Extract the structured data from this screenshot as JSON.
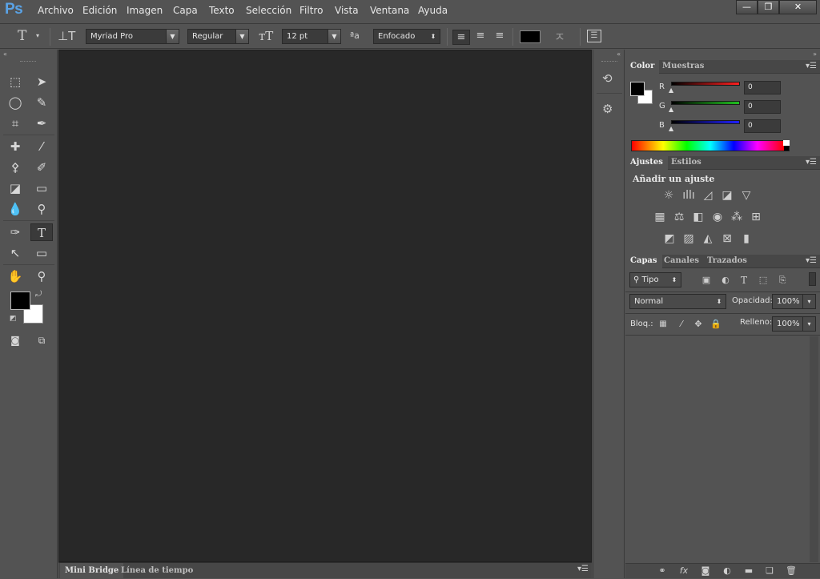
{
  "app": {
    "logo": "Ps",
    "accent": "#5aa3e6"
  },
  "menu": [
    "Archivo",
    "Edición",
    "Imagen",
    "Capa",
    "Texto",
    "Selección",
    "Filtro",
    "Vista",
    "Ventana",
    "Ayuda"
  ],
  "window_buttons": {
    "minimize": "—",
    "restore": "❐",
    "close": "✕"
  },
  "options": {
    "font_family": "Myriad Pro",
    "font_style": "Regular",
    "font_size": "12 pt",
    "antialias": "Enfocado",
    "text_color": "#000000"
  },
  "tools_icons": [
    "marquee-icon",
    "move-icon",
    "lasso-icon",
    "quick-selection-icon",
    "crop-icon",
    "eyedropper-icon",
    "healing-icon",
    "brush-icon",
    "stamp-icon",
    "history-brush-icon",
    "eraser-icon",
    "gradient-icon",
    "blur-icon",
    "dodge-icon",
    "pen-icon",
    "type-icon",
    "path-selection-icon",
    "rectangle-icon",
    "hand-icon",
    "zoom-icon"
  ],
  "colors": {
    "foreground": "#000000",
    "background": "#ffffff"
  },
  "bottom_tabs": [
    "Mini Bridge",
    "Línea de tiempo"
  ],
  "color_panel": {
    "tabs": [
      "Color",
      "Muestras"
    ],
    "channels": [
      {
        "label": "R",
        "value": "0",
        "color": "#ff2020"
      },
      {
        "label": "G",
        "value": "0",
        "color": "#20c020"
      },
      {
        "label": "B",
        "value": "0",
        "color": "#2020ff"
      }
    ]
  },
  "adjustments_panel": {
    "tabs": [
      "Ajustes",
      "Estilos"
    ],
    "heading": "Añadir un ajuste"
  },
  "layers_panel": {
    "tabs": [
      "Capas",
      "Canales",
      "Trazados"
    ],
    "filter_kind": "Tipo",
    "blend_mode": "Normal",
    "opacity_label": "Opacidad:",
    "opacity_value": "100%",
    "lock_label": "Bloq.:",
    "fill_label": "Relleno:",
    "fill_value": "100%"
  }
}
